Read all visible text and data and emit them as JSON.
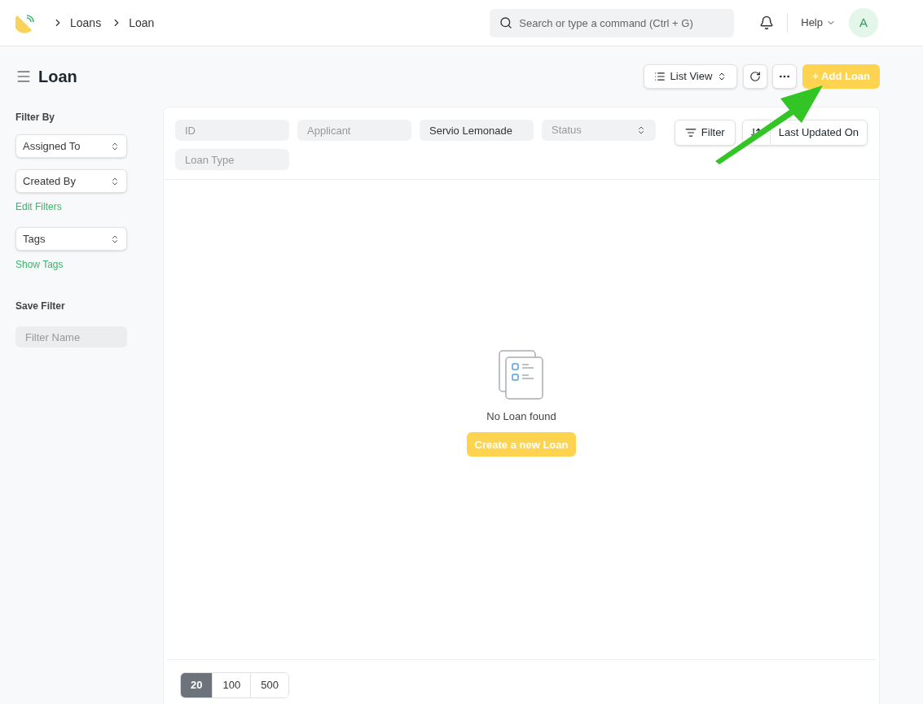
{
  "breadcrumbs": [
    "Loans",
    "Loan"
  ],
  "search": {
    "placeholder": "Search or type a command (Ctrl + G)"
  },
  "help": "Help",
  "avatar": "A",
  "page_title": "Loan",
  "toolbar": {
    "view": "List View",
    "primary": "+ Add Loan"
  },
  "sidebar": {
    "heading": "Filter By",
    "filters": [
      {
        "label": "Assigned To"
      },
      {
        "label": "Created By"
      }
    ],
    "edit_link": "Edit Filters",
    "tags": "Tags",
    "tags_link": "Show Tags",
    "save_heading": "Save Filter",
    "filter_name": {
      "placeholder": "Filter Name"
    }
  },
  "filters": [
    {
      "kind": "text",
      "placeholder": "ID"
    },
    {
      "kind": "text",
      "placeholder": "Applicant"
    },
    {
      "kind": "text",
      "value": "Servio Lemonade"
    },
    {
      "kind": "select",
      "placeholder": "Status"
    },
    {
      "kind": "text",
      "placeholder": "Loan Type"
    }
  ],
  "filter_button": "Filter",
  "sort": "Last Updated On",
  "empty": {
    "message": "No Loan found",
    "button": "Create a new Loan"
  },
  "page_sizes": [
    {
      "label": "20",
      "selected": true
    },
    {
      "label": "100",
      "selected": false
    },
    {
      "label": "500",
      "selected": false
    }
  ]
}
